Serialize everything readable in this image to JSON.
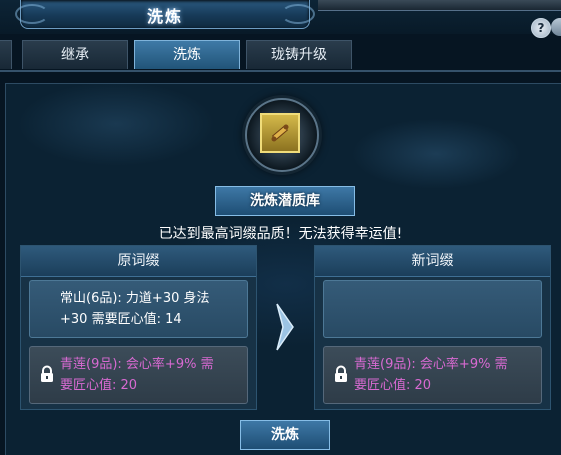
{
  "window": {
    "title": "洗炼"
  },
  "tabs": [
    {
      "label": "继承",
      "active": false
    },
    {
      "label": "洗炼",
      "active": true
    },
    {
      "label": "珑铸升级",
      "active": false
    }
  ],
  "header": {
    "library_label": "洗炼潜质库"
  },
  "notice": "已达到最高词缀品质！无法获得幸运值!",
  "original": {
    "title": "原词缀",
    "affix_line1": "常山(6品): 力道+30 身法",
    "affix_line2": "+30 需要匠心值: 14",
    "locked_line1": "青莲(9品): 会心率+9% 需",
    "locked_line2": "要匠心值: 20"
  },
  "new": {
    "title": "新词缀",
    "affix": "",
    "locked_line1": "青莲(9品): 会心率+9% 需",
    "locked_line2": "要匠心值: 20"
  },
  "actions": {
    "wash_label": "洗炼",
    "help_label": "?"
  },
  "colors": {
    "accent": "#3e78a6",
    "locked_text": "#d86ad2",
    "background": "#0b2233"
  },
  "icons": [
    "scroll-icon",
    "lock-icon",
    "chevron-right-icon",
    "help-icon",
    "close-icon"
  ]
}
